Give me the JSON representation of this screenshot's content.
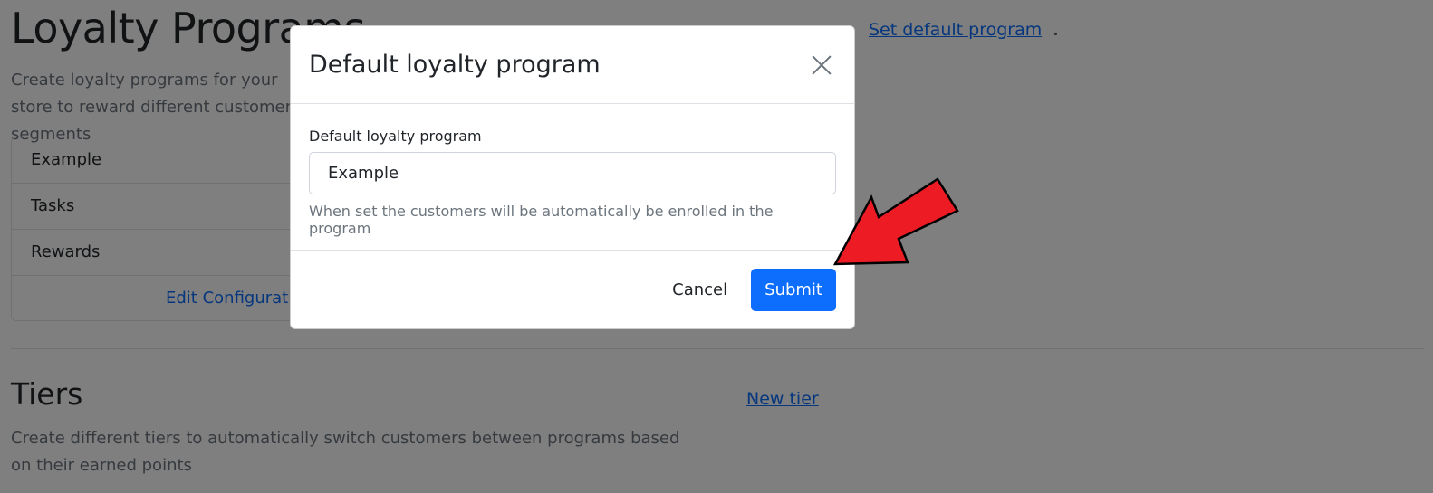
{
  "page": {
    "title": "Loyalty Programs",
    "description": "Create loyalty programs for your store to reward different customer segments",
    "set_default_link": "Set default program"
  },
  "program_card": {
    "rows": [
      "Example",
      "Tasks",
      "Rewards"
    ],
    "edit_link": "Edit Configuration"
  },
  "tiers": {
    "title": "Tiers",
    "description": "Create different tiers to automatically switch customers between programs based on their earned points",
    "new_tier_link": "New tier"
  },
  "modal": {
    "title": "Default loyalty program",
    "field_label": "Default loyalty program",
    "selected_value": "Example",
    "help_text": "When set the customers will be automatically be enrolled in the program",
    "cancel_label": "Cancel",
    "submit_label": "Submit"
  },
  "colors": {
    "primary": "#0d6efd",
    "arrow": "#ed1c24",
    "backdrop": "rgba(0,0,0,0.5)"
  }
}
